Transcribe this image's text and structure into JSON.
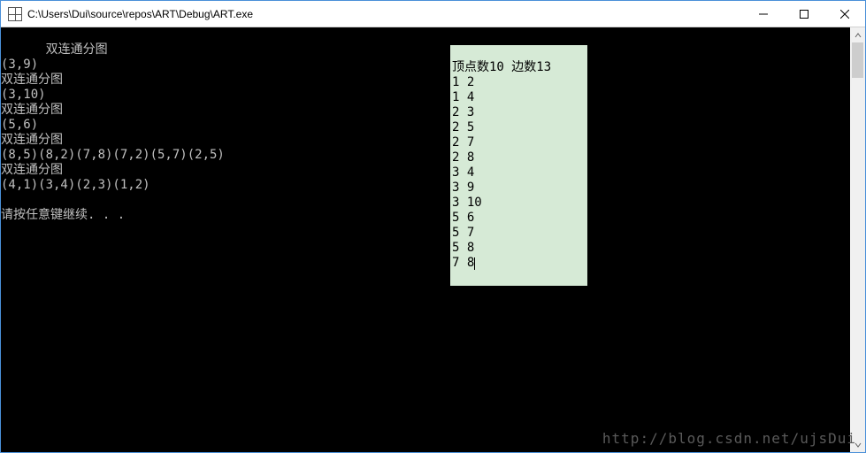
{
  "titlebar": {
    "title": "C:\\Users\\Dui\\source\\repos\\ART\\Debug\\ART.exe"
  },
  "console": {
    "lines": [
      "双连通分图",
      "(3,9)",
      "双连通分图",
      "(3,10)",
      "双连通分图",
      "(5,6)",
      "双连通分图",
      "(8,5)(8,2)(7,8)(7,2)(5,7)(2,5)",
      "双连通分图",
      "(4,1)(3,4)(2,3)(1,2)",
      "",
      "请按任意键继续. . ."
    ]
  },
  "overlay": {
    "header": "顶点数10 边数13",
    "edges": [
      "1 2",
      "1 4",
      "2 3",
      "2 5",
      "2 7",
      "2 8",
      "3 4",
      "3 9",
      "3 10",
      "5 6",
      "5 7",
      "5 8",
      "7 8"
    ]
  },
  "watermark": "http://blog.csdn.net/ujsDui"
}
